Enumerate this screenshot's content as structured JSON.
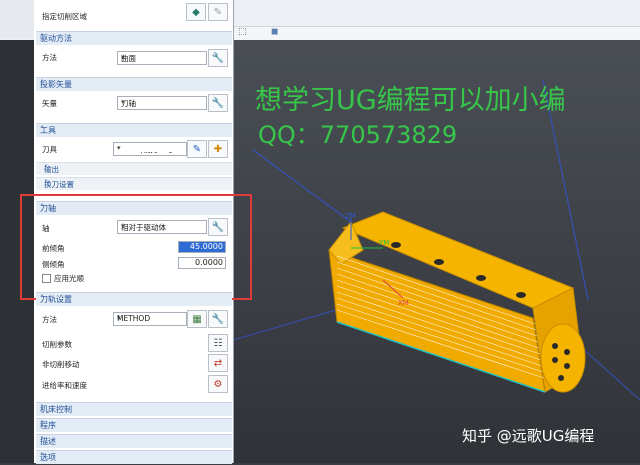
{
  "panel": {
    "top_row": {
      "label": "指定切削区域"
    },
    "sections": {
      "drive": {
        "title": "驱动方法",
        "method_label": "方法",
        "method_value": "曲面"
      },
      "projection": {
        "title": "投影矢量",
        "vector_label": "矢量",
        "vector_value": "刀轴"
      },
      "tool": {
        "title": "工具",
        "tool_label": "刀具",
        "tool_value": "D4R2 (铣刀-5 参",
        "output": "输出",
        "change_tool": "换刀设置"
      },
      "tool_axis": {
        "title": "刀轴",
        "axis_label": "轴",
        "axis_value": "相对于驱动体",
        "lead_label": "前倾角",
        "lead_value": "45.0000",
        "tilt_label": "侧倾角",
        "tilt_value": "0.0000",
        "smooth_label": "应用光顺"
      },
      "path_settings": {
        "title": "刀轨设置",
        "method_label": "方法",
        "method_value": "METHOD",
        "cut_params": "切削参数",
        "non_cut": "非切削移动",
        "feeds": "进给率和速度"
      },
      "collapsed": [
        "机床控制",
        "程序",
        "描述",
        "选项"
      ]
    }
  },
  "watermark": {
    "line1": "想学习UG编程可以加小编",
    "line2": "QQ：770573829"
  },
  "credit": "知乎 @远歌UG编程",
  "axis_labels": {
    "zm": "ZM",
    "ym": "YM",
    "xm": "XM"
  },
  "colors": {
    "part": "#f5b400",
    "header_text": "#1f4f95",
    "highlight": "#e03a3a",
    "watermark": "#37c64a"
  }
}
